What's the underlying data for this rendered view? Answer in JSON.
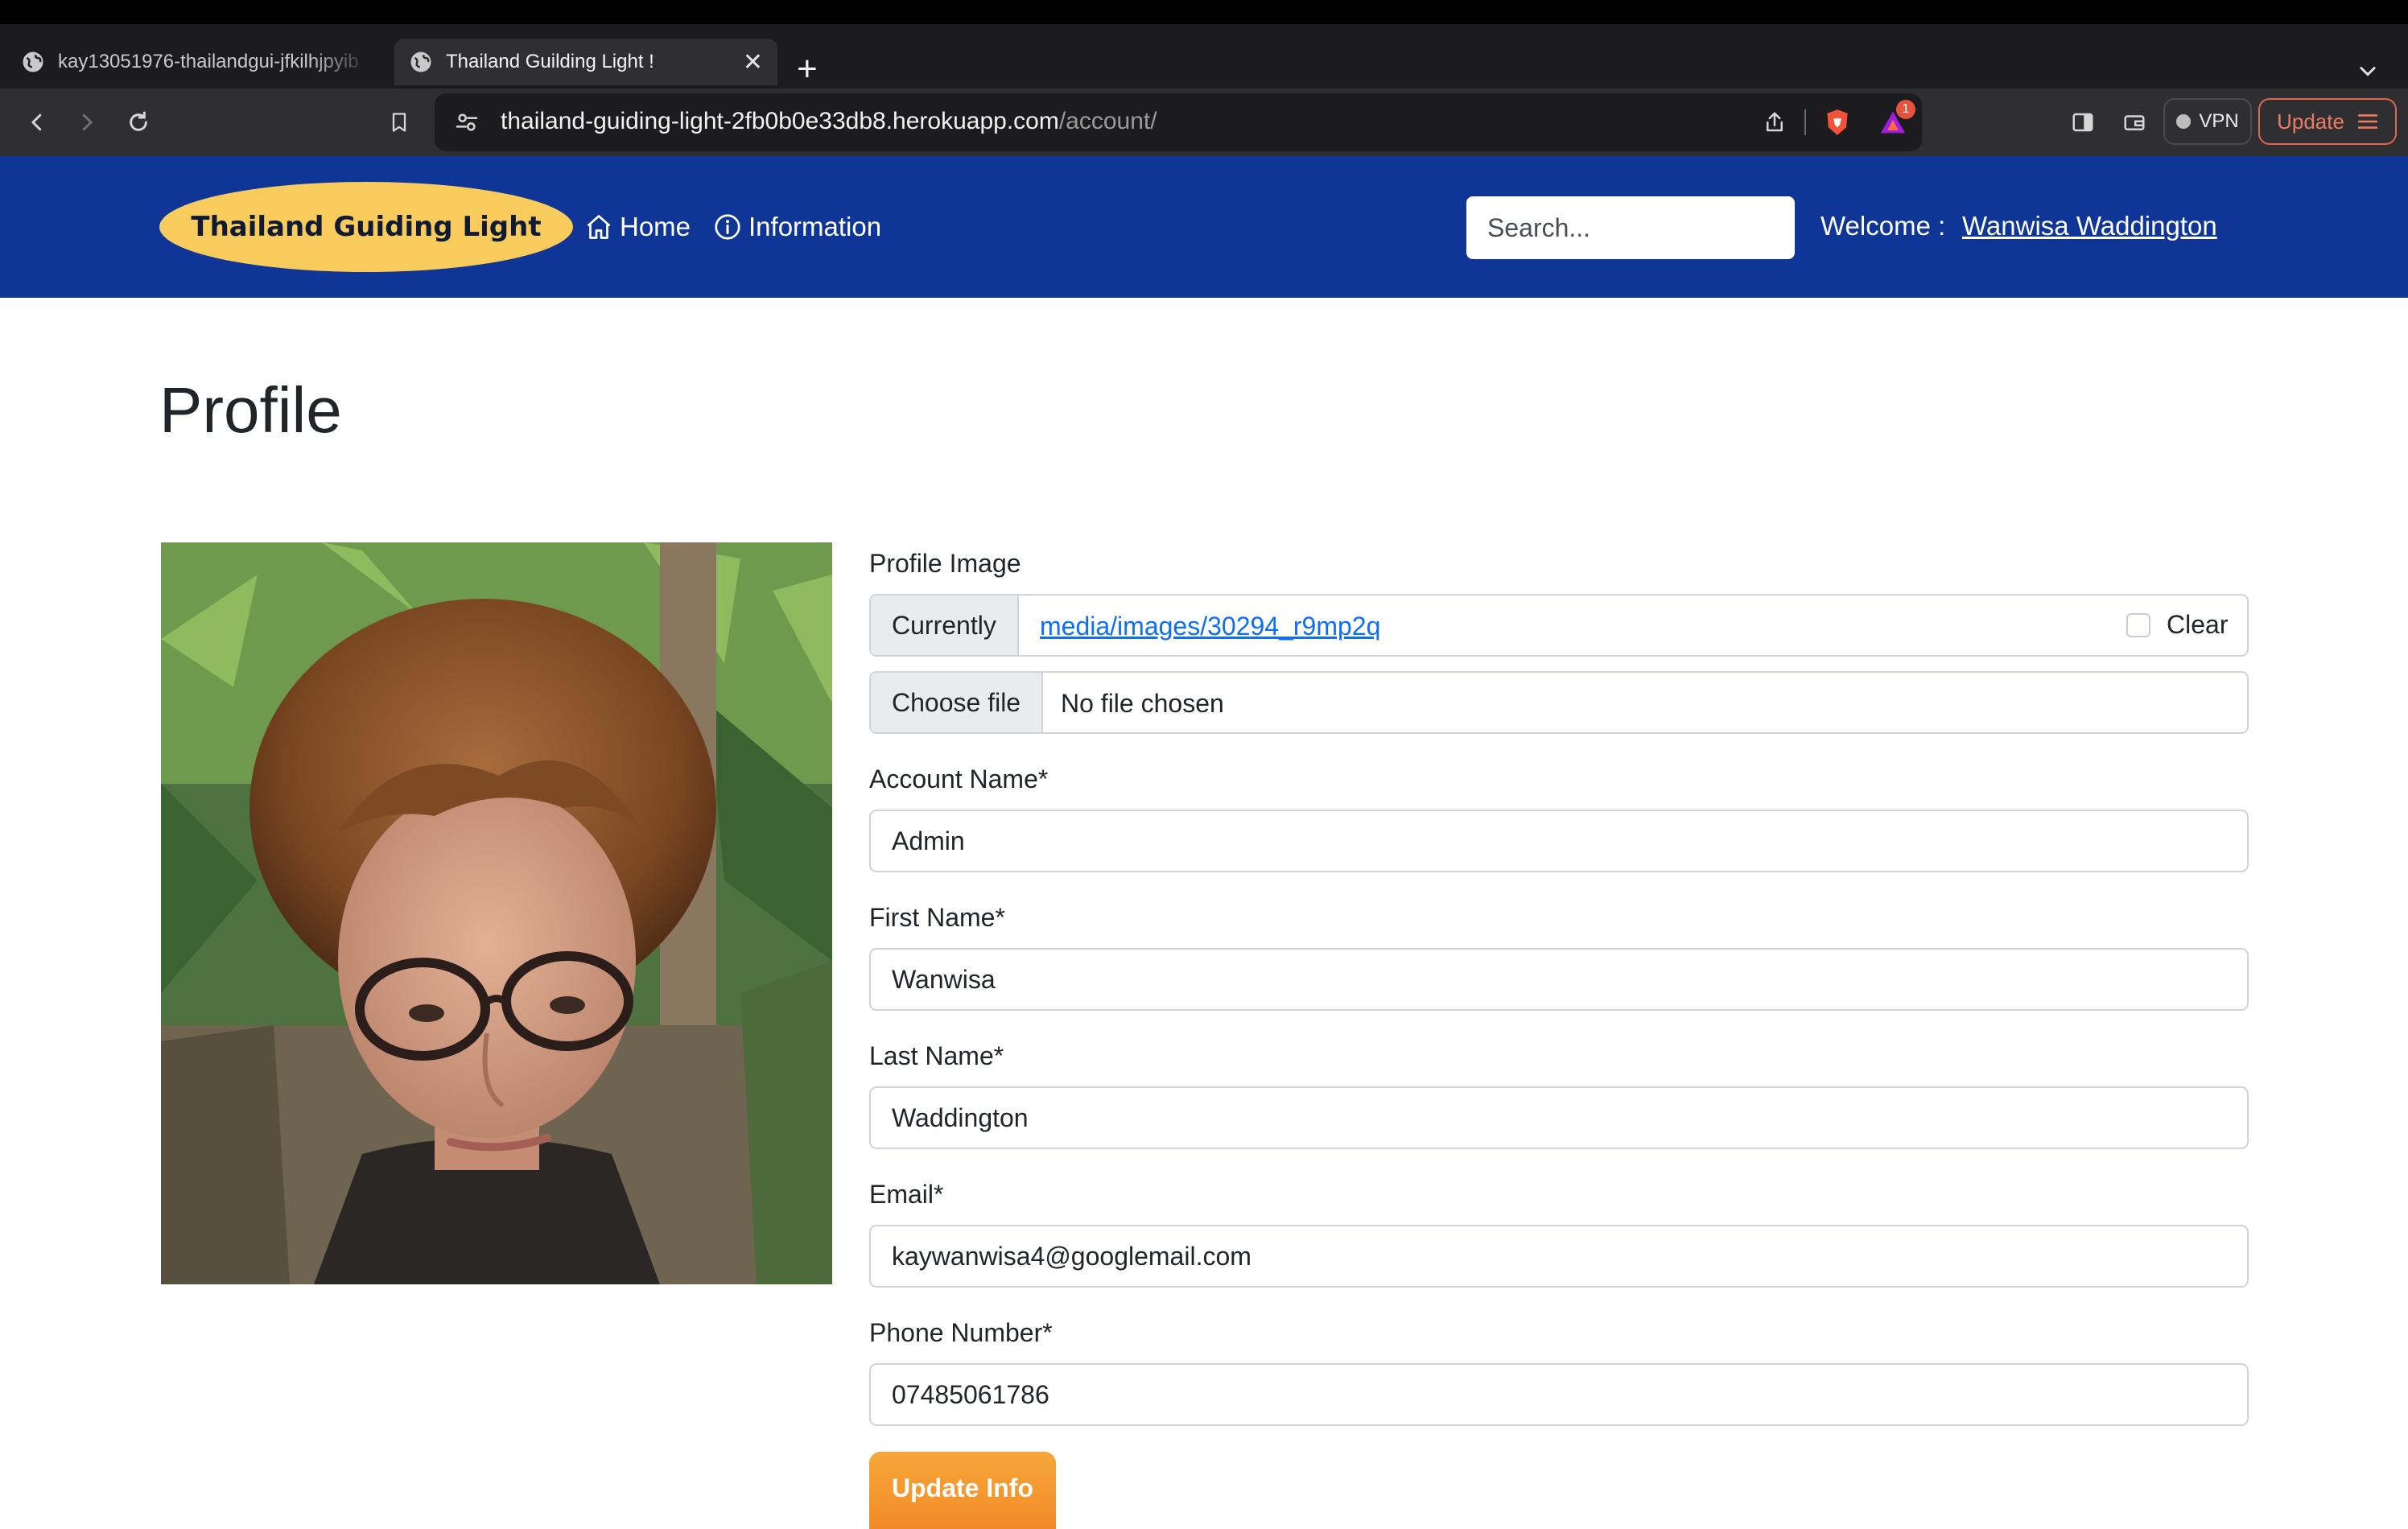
{
  "browser": {
    "tabs": [
      {
        "title": "kay13051976-thailandgui-jfkilhjpyib",
        "active": false
      },
      {
        "title": "Thailand Guilding Light !",
        "active": true
      }
    ],
    "url_host": "thailand-guiding-light-2fb0b0e33db8.herokuapp.com",
    "url_path": "/account/",
    "notification_count": "1",
    "vpn_label": "VPN",
    "update_label": "Update"
  },
  "navbar": {
    "brand": "Thailand Guiding Light",
    "links": [
      {
        "label": "Home",
        "icon": "house-icon"
      },
      {
        "label": "Information",
        "icon": "info-circle-icon"
      }
    ],
    "search_placeholder": "Search...",
    "welcome_label": "Welcome :",
    "user_name": "Wanwisa Waddington",
    "bg_color": "#0f3596",
    "brand_color": "#f7cc5c"
  },
  "page": {
    "title": "Profile"
  },
  "form": {
    "profile_image": {
      "label": "Profile Image",
      "currently_label": "Currently",
      "current_file": "media/images/30294_r9mp2q",
      "clear_label": "Clear",
      "choose_file_label": "Choose file",
      "no_file_text": "No file chosen"
    },
    "account_name": {
      "label": "Account Name*",
      "value": "Admin"
    },
    "first_name": {
      "label": "First Name*",
      "value": "Wanwisa"
    },
    "last_name": {
      "label": "Last Name*",
      "value": "Waddington"
    },
    "email": {
      "label": "Email*",
      "value": "kaywanwisa4@googlemail.com"
    },
    "phone": {
      "label": "Phone Number*",
      "value": "07485061786"
    },
    "submit_label": "Update Info",
    "submit_color": "#f28a25"
  }
}
